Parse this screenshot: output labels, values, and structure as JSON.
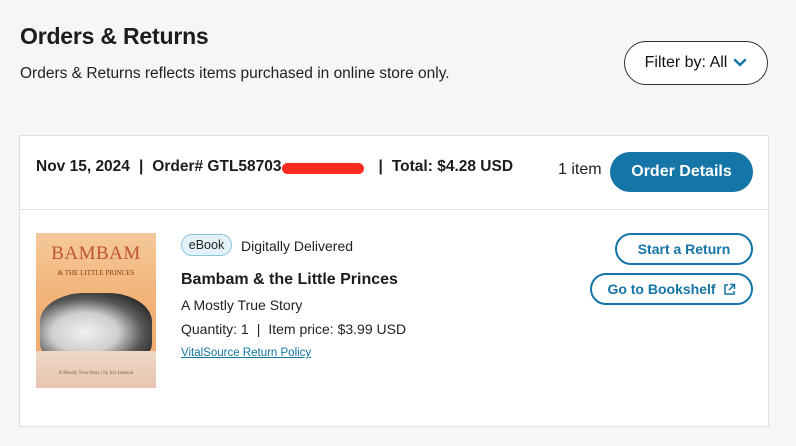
{
  "page": {
    "title": "Orders & Returns",
    "subtitle": "Orders & Returns reflects items purchased in online store only."
  },
  "filter": {
    "label": "Filter by: All",
    "icon": "chevron-down-icon"
  },
  "order": {
    "date": "Nov 15, 2024",
    "order_label": "Order# GTL58703",
    "total": "Total: $4.28 USD",
    "item_count": "1 item",
    "details_button": "Order Details"
  },
  "item": {
    "badge": "eBook",
    "delivery_status": "Digitally Delivered",
    "title": "Bambam & the Little Princes",
    "subtitle": "A Mostly True Story",
    "quantity": "Quantity: 1",
    "price": "Item price: $3.99 USD",
    "policy_link": "VitalSource Return Policy",
    "cover": {
      "title": "BAMBAM",
      "subtitle": "& THE LITTLE PRINCES",
      "footer": "A Mostly True Story | by Iris Jackson"
    },
    "actions": {
      "return_button": "Start a Return",
      "bookshelf_button": "Go to Bookshelf",
      "bookshelf_icon": "external-link-icon"
    }
  },
  "colors": {
    "accent": "#1475a6",
    "redaction": "#ff2a1f",
    "background": "#f6f6f7"
  }
}
